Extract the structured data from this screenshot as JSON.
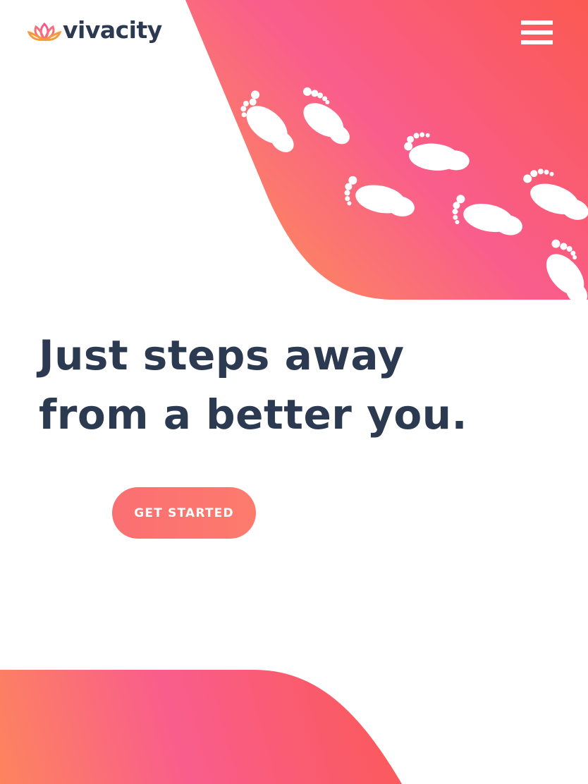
{
  "header": {
    "brand": "vivacity",
    "logo_icon": "lotus-icon",
    "menu_icon": "hamburger-menu-icon"
  },
  "hero": {
    "headline_line1": "Just steps away",
    "headline_line2": "from a better you.",
    "decoration_icon": "footprints-icon",
    "cta_label": "GET STARTED"
  },
  "colors": {
    "text": "#2b3951",
    "gradient_orange": "#fd8560",
    "gradient_pink": "#f95a8e",
    "gradient_red": "#fb5a5a",
    "logo_orange": "#f89a3c",
    "logo_pink": "#f55a8a"
  }
}
